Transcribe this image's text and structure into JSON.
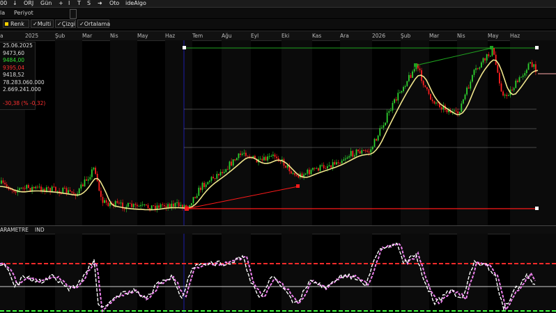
{
  "toolbar": {
    "left_value": "00",
    "download_icon": "↓",
    "orj": "ORJ",
    "period": "Gün",
    "add": "+",
    "i": "I",
    "t": "T",
    "s": "S",
    "arrow_icon": "➜",
    "oto": "Oto",
    "idealgo": "ideAlgo"
  },
  "row2": {
    "left_label": "la",
    "periyot": "Periyot"
  },
  "toggles": {
    "renk": "Renk",
    "multi": "Multi",
    "cizgi": "Çizgi",
    "ortalama": "Ortalama",
    "check": "✓"
  },
  "months": [
    "a",
    "2025",
    "Şub",
    "Mar",
    "Nis",
    "May",
    "Haz",
    "Tem",
    "Ağu",
    "Eyl",
    "Eki",
    "Kas",
    "Ara",
    "2026",
    "Şub",
    "Mar",
    "Nis",
    "May",
    "Haz"
  ],
  "info": {
    "date": "25.06.2025",
    "open": "9473,60",
    "high": "9484,00",
    "low": "9395,04",
    "close": "9418,52",
    "volume": "78.283.060.000",
    "amount": "2.669.241.000",
    "change": "-30,38 (% -0,32)"
  },
  "indicator_bar": {
    "param": "ARAMETRE",
    "name": "IND"
  },
  "colors": {
    "up": "#2fd12f",
    "down": "#ff2020",
    "ma": "#f0e68c",
    "osc_main": "#ffffff",
    "osc_sig": "#ee82ee",
    "upper": "#ff2a2a",
    "lower": "#44ff44"
  }
}
